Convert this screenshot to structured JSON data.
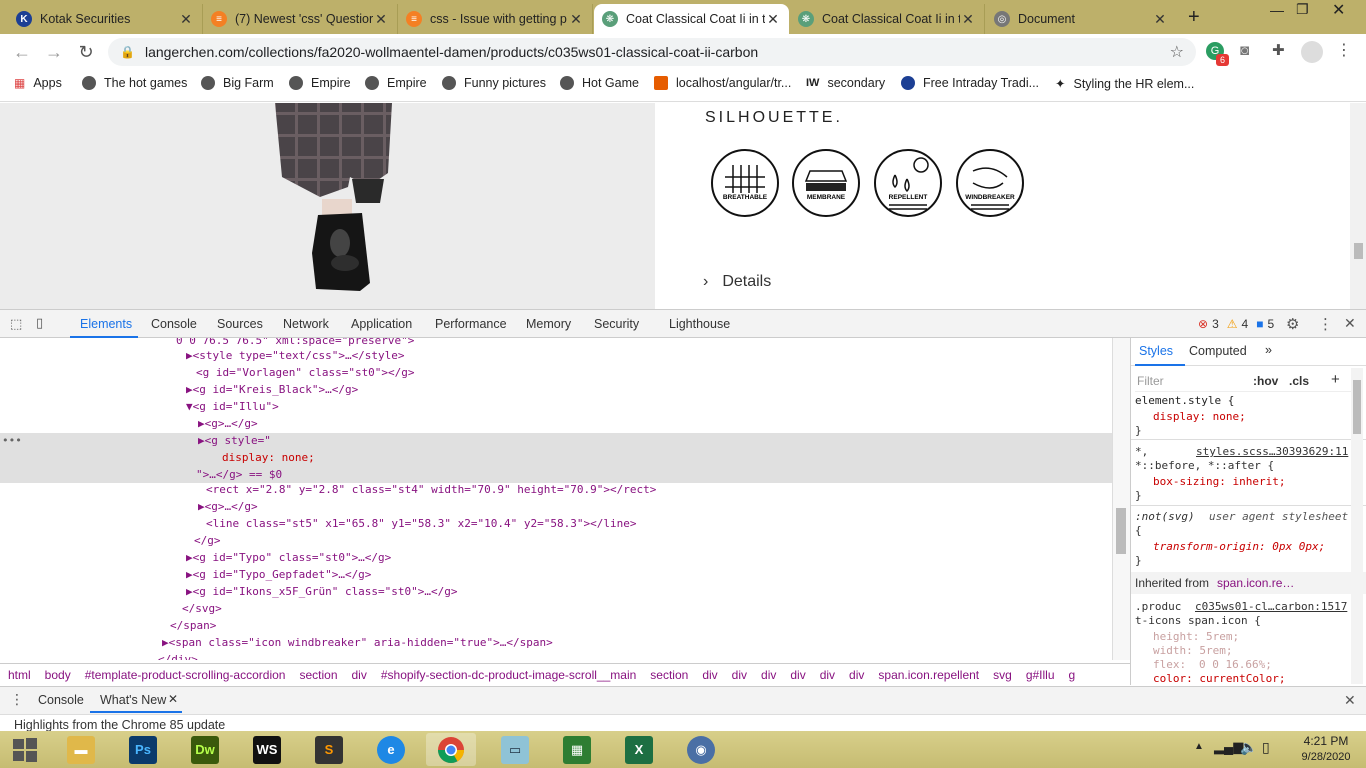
{
  "browser": {
    "tabs": [
      {
        "title": "Kotak Securities",
        "favicon": "kotak-icon",
        "color": "#1c3f94"
      },
      {
        "title": "(7) Newest 'css' Questior",
        "favicon": "stackoverflow-icon",
        "color": "#f48024"
      },
      {
        "title": "css - Issue with getting p",
        "favicon": "stackoverflow-icon",
        "color": "#f48024"
      },
      {
        "title": "Coat Classical Coat Ii in t",
        "favicon": "langerchen-icon",
        "color": "#5a9f7a"
      },
      {
        "title": "Coat Classical Coat Ii in t",
        "favicon": "langerchen-icon",
        "color": "#5a9f7a"
      },
      {
        "title": "Document",
        "favicon": "globe-icon",
        "color": "#777777"
      }
    ],
    "url": "langerchen.com/collections/fa2020-wollmaentel-damen/products/c035ws01-classical-coat-ii-carbon",
    "extension_badge": "6",
    "bookmarks": [
      "Apps",
      "The hot games",
      "Big Farm",
      "Empire",
      "Empire",
      "Funny pictures",
      "Hot Game",
      "localhost/angular/tr...",
      "secondary",
      "Free Intraday Tradi...",
      "Styling the HR elem..."
    ],
    "bookmark_prefix_iw": "IW"
  },
  "page": {
    "silhouette": "SILHOUETTE.",
    "badges": [
      "BREATHABLE",
      "MEMBRANE",
      "REPELLENT",
      "WINDBREAKER"
    ],
    "details": "Details"
  },
  "devtools": {
    "tabs": [
      "Elements",
      "Console",
      "Sources",
      "Network",
      "Application",
      "Performance",
      "Memory",
      "Security",
      "Lighthouse"
    ],
    "errors": "3",
    "warnings": "4",
    "infos": "5",
    "elements_lines": [
      "0 0 76.5 76.5\" xml:space=\"preserve\">",
      "▶<style type=\"text/css\">…</style>",
      "<g id=\"Vorlagen\" class=\"st0\"></g>",
      "▶<g id=\"Kreis_Black\">…</g>",
      "▼<g id=\"Illu\">",
      "▶<g>…</g>",
      "▶<g style=\"",
      "display: none;",
      "\">…</g> == $0",
      "<rect x=\"2.8\" y=\"2.8\" class=\"st4\" width=\"70.9\" height=\"70.9\"></rect>",
      "▶<g>…</g>",
      "<line class=\"st5\" x1=\"65.8\" y1=\"58.3\" x2=\"10.4\" y2=\"58.3\"></line>",
      "</g>",
      "▶<g id=\"Typo\" class=\"st0\">…</g>",
      "▶<g id=\"Typo_Gepfadet\">…</g>",
      "▶<g id=\"Ikons_x5F_Grün\" class=\"st0\">…</g>",
      "</svg>",
      "</span>",
      "▶<span class=\"icon windbreaker\" aria-hidden=\"true\">…</span>",
      "</div>"
    ],
    "styles_tabs": [
      "Styles",
      "Computed",
      "»"
    ],
    "filter_placeholder": "Filter",
    "hov": ":hov",
    "cls": ".cls",
    "style_lines": [
      "element.style {",
      "display: none;",
      "}",
      "*,",
      "styles.scss…30393629:11",
      "*::before, *::after {",
      "box-sizing: inherit;",
      "}",
      ":not(svg)",
      "user agent stylesheet",
      "{",
      "transform-origin: 0px 0px;",
      "}",
      "Inherited from",
      "span.icon.re…",
      ".produc",
      "c035ws01-cl…carbon:1517",
      "t-icons span.icon {",
      "height: 5rem;",
      "width: 5rem;",
      "flex:",
      "0 0 16.66%;",
      "color: currentColor;"
    ],
    "breadcrumbs": [
      "html",
      "body",
      "#template-product-scrolling-accordion",
      "section",
      "div",
      "#shopify-section-dc-product-image-scroll__main",
      "section",
      "div",
      "div",
      "div",
      "div",
      "div",
      "div",
      "span.icon.repellent",
      "svg",
      "g#Illu",
      "g"
    ],
    "drawer_tabs": [
      "Console",
      "What's New"
    ],
    "drawer_text": "Highlights from the Chrome 85 update"
  },
  "taskbar": {
    "apps": [
      "start",
      "explorer",
      "Ps",
      "Dw",
      "WS",
      "sublime",
      "ie",
      "chrome",
      "notepad",
      "calculator",
      "excel",
      "network"
    ],
    "time": "4:21 PM",
    "date": "9/28/2020"
  }
}
